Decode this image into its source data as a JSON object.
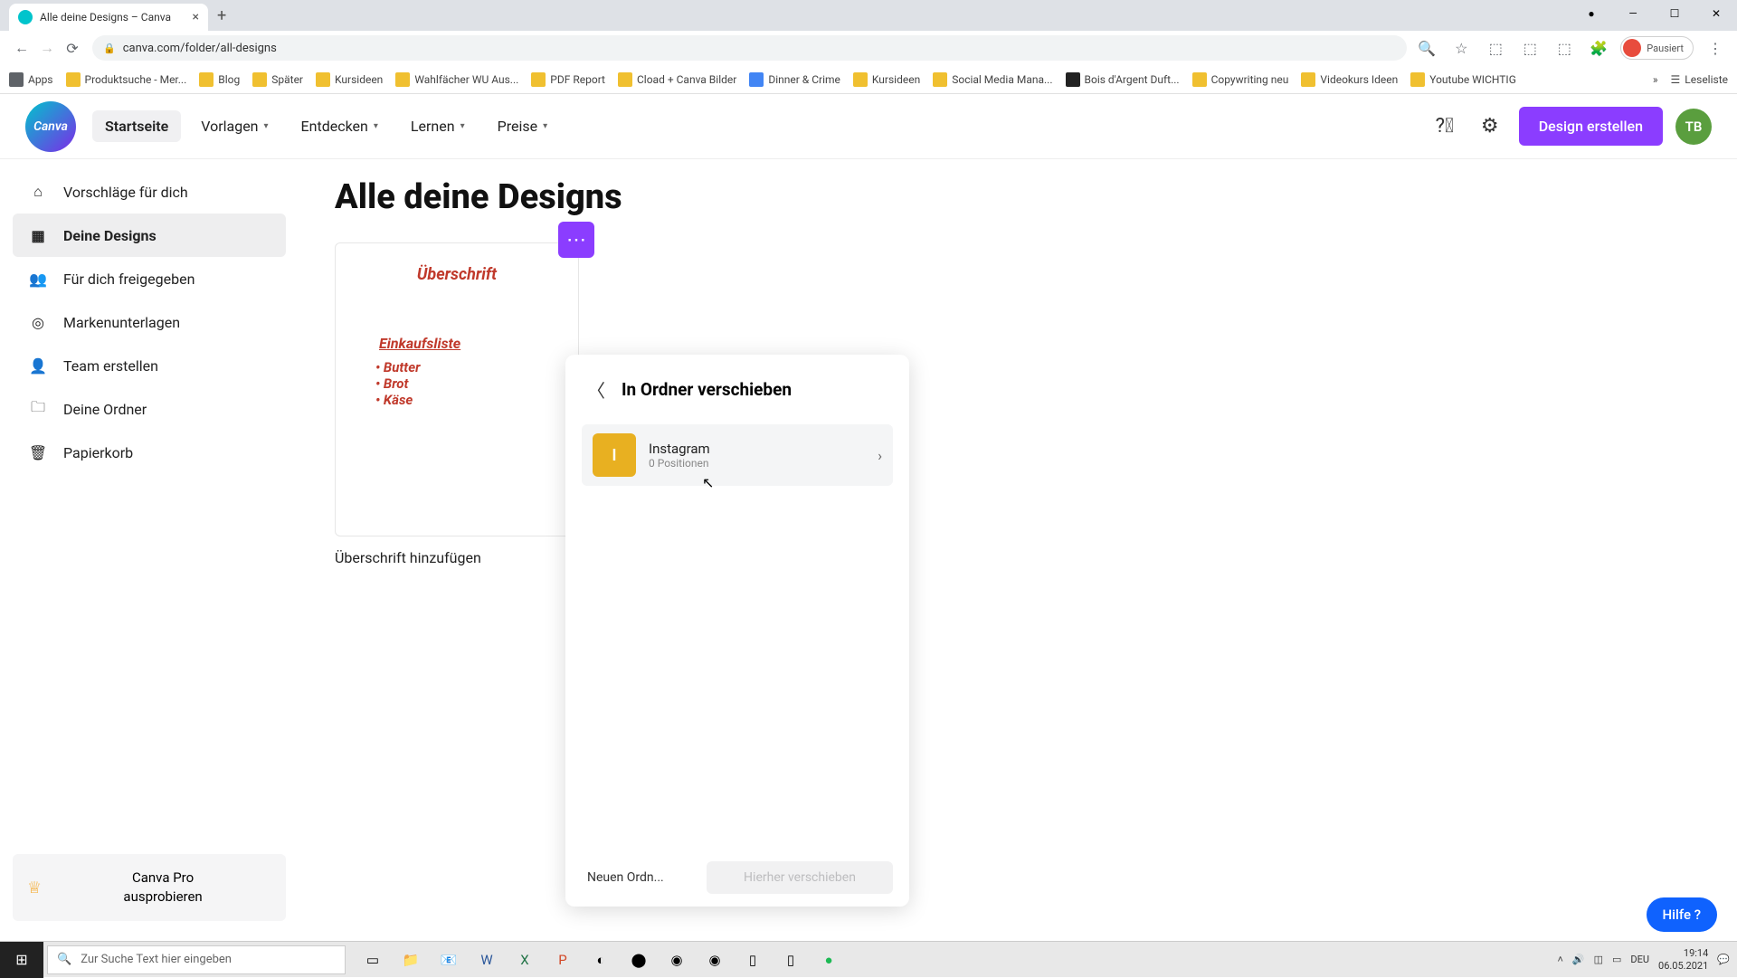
{
  "browser": {
    "tab_title": "Alle deine Designs – Canva",
    "url": "canva.com/folder/all-designs",
    "pausiert": "Pausiert",
    "bookmarks": [
      "Apps",
      "Produktsuche - Mer...",
      "Blog",
      "Später",
      "Kursideen",
      "Wahlfächer WU Aus...",
      "PDF Report",
      "Cload + Canva Bilder",
      "Dinner & Crime",
      "Kursideen",
      "Social Media Mana...",
      "Bois d'Argent Duft...",
      "Copywriting neu",
      "Videokurs Ideen",
      "Youtube WICHTIG"
    ],
    "bookmark_reading": "Leseliste"
  },
  "header": {
    "logo": "Canva",
    "nav": {
      "home": "Startseite",
      "templates": "Vorlagen",
      "discover": "Entdecken",
      "learn": "Lernen",
      "pricing": "Preise"
    },
    "create": "Design erstellen",
    "avatar": "TB"
  },
  "sidebar": {
    "items": [
      "Vorschläge für dich",
      "Deine Designs",
      "Für dich freigegeben",
      "Markenunterlagen",
      "Team erstellen",
      "Deine Ordner",
      "Papierkorb"
    ],
    "pro_line1": "Canva Pro",
    "pro_line2": "ausprobieren"
  },
  "main": {
    "title": "Alle deine Designs",
    "card": {
      "heading": "Überschrift",
      "list_title": "Einkaufsliste",
      "items": [
        "Butter",
        "Brot",
        "Käse"
      ],
      "caption": "Überschrift hinzufügen"
    }
  },
  "popover": {
    "title": "In Ordner verschieben",
    "folder": {
      "letter": "I",
      "name": "Instagram",
      "sub": "0 Positionen"
    },
    "new_folder": "Neuen Ordn...",
    "move_here": "Hierher verschieben"
  },
  "help": "Hilfe ?",
  "taskbar": {
    "search_placeholder": "Zur Suche Text hier eingeben",
    "lang": "DEU",
    "time": "19:14",
    "date": "06.05.2021"
  }
}
